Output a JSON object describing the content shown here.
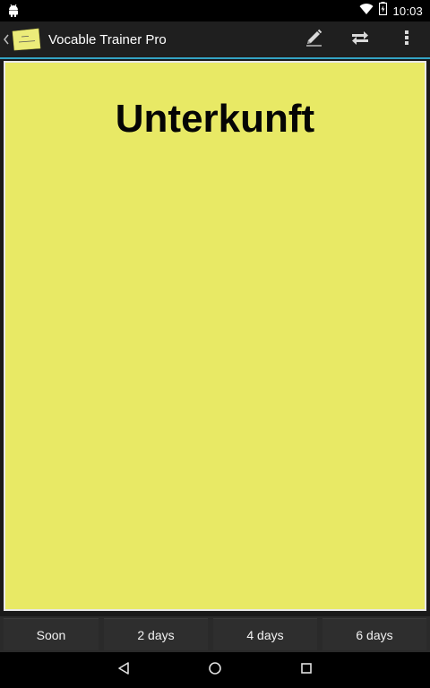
{
  "status_bar": {
    "time": "10:03",
    "icons": [
      "android-icon",
      "wifi-icon",
      "battery-icon"
    ]
  },
  "action_bar": {
    "title": "Vocable Trainer Pro",
    "actions": [
      "pencil-icon",
      "swap-icon",
      "overflow-menu-icon"
    ]
  },
  "card": {
    "word": "Unterkunft",
    "color": "#e8e965"
  },
  "schedule_buttons": [
    {
      "label": "Soon"
    },
    {
      "label": "2 days"
    },
    {
      "label": "4 days"
    },
    {
      "label": "6 days"
    }
  ],
  "nav_bar": {
    "buttons": [
      "back-icon",
      "home-icon",
      "recents-icon"
    ]
  },
  "colors": {
    "accent": "#33a3c4",
    "action_bar_bg": "#1f1f1f",
    "card_bg": "#e8e965"
  }
}
